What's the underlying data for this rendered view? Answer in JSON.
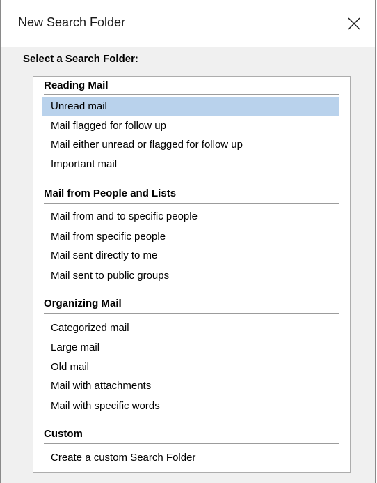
{
  "window": {
    "title": "New Search Folder",
    "close_icon": "close-icon"
  },
  "prompt": "Select a Search Folder:",
  "groups": [
    {
      "header": "Reading Mail",
      "items": [
        {
          "label": "Unread mail",
          "selected": true
        },
        {
          "label": "Mail flagged for follow up",
          "selected": false
        },
        {
          "label": "Mail either unread or flagged for follow up",
          "selected": false
        },
        {
          "label": "Important mail",
          "selected": false
        }
      ]
    },
    {
      "header": "Mail from People and Lists",
      "items": [
        {
          "label": "Mail from and to specific people",
          "selected": false
        },
        {
          "label": "Mail from specific people",
          "selected": false
        },
        {
          "label": "Mail sent directly to me",
          "selected": false
        },
        {
          "label": "Mail sent to public groups",
          "selected": false
        }
      ]
    },
    {
      "header": "Organizing Mail",
      "items": [
        {
          "label": "Categorized mail",
          "selected": false
        },
        {
          "label": "Large mail",
          "selected": false
        },
        {
          "label": "Old mail",
          "selected": false
        },
        {
          "label": "Mail with attachments",
          "selected": false
        },
        {
          "label": "Mail with specific words",
          "selected": false
        }
      ]
    },
    {
      "header": "Custom",
      "items": [
        {
          "label": "Create a custom Search Folder",
          "selected": false
        }
      ]
    }
  ],
  "colors": {
    "selection": "#b9d2ec",
    "dialog_background": "#f0f0f0",
    "list_background": "#ffffff"
  }
}
